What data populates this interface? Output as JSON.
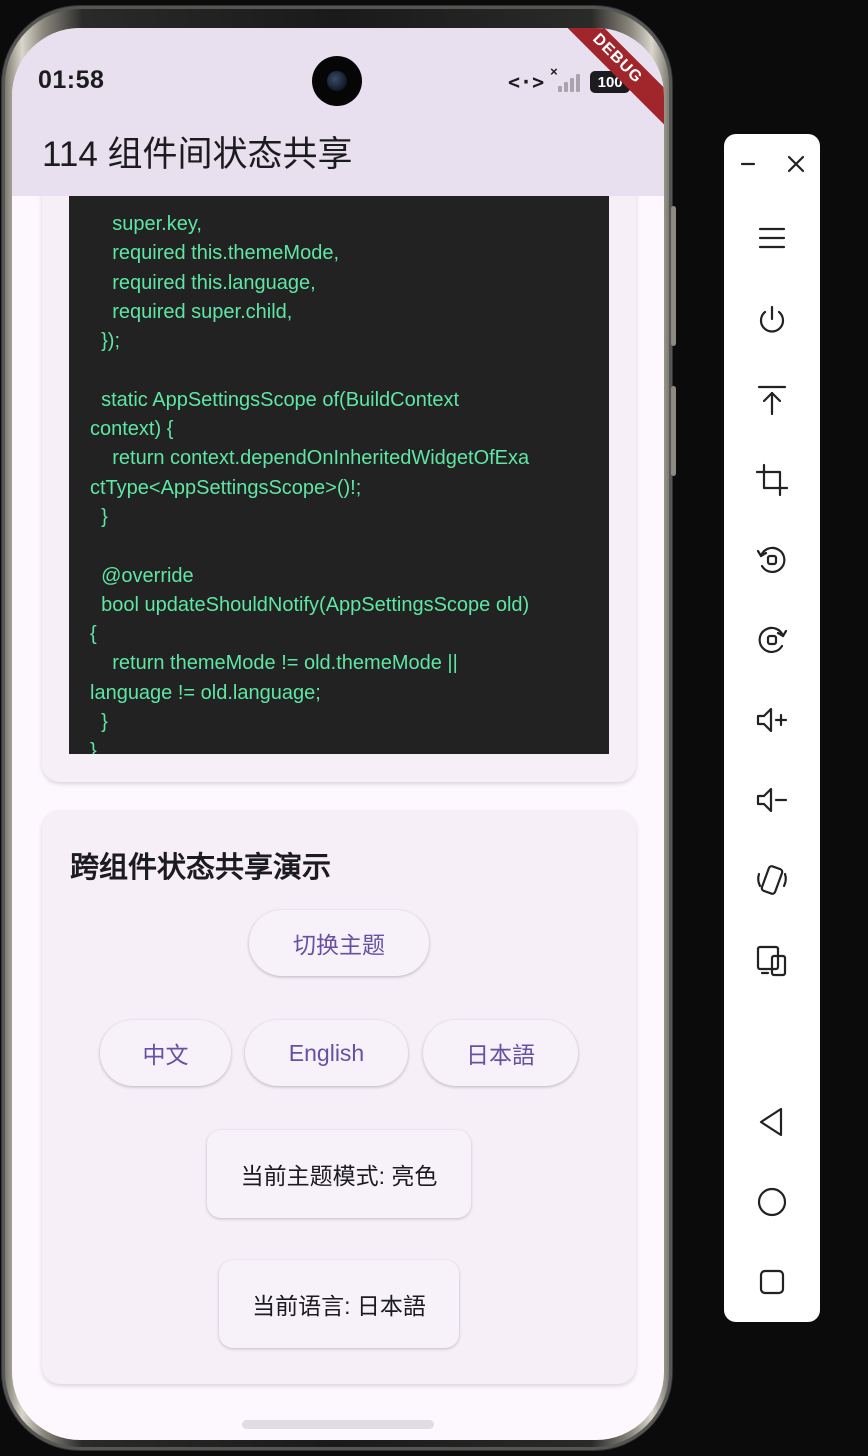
{
  "status_bar": {
    "time": "01:58",
    "battery": "100",
    "network_glyph": "<·>",
    "signal_mark": "×"
  },
  "debug_banner": "DEBUG",
  "app_bar": {
    "title": "114 组件间状态共享"
  },
  "code_block": {
    "lines": [
      "    super.key,",
      "    required this.themeMode,",
      "    required this.language,",
      "    required super.child,",
      "  });",
      "",
      "  static AppSettingsScope of(BuildContext",
      "context) {",
      "    return context.dependOnInheritedWidgetOfExa",
      "ctType<AppSettingsScope>()!;",
      "  }",
      "",
      "  @override",
      "  bool updateShouldNotify(AppSettingsScope old)",
      "{",
      "    return themeMode != old.themeMode ||",
      "language != old.language;",
      "  }",
      "}"
    ],
    "text_color": "#5ee6a4",
    "background": "#222222"
  },
  "demo": {
    "title": "跨组件状态共享演示",
    "toggle_theme_label": "切换主题",
    "language_buttons": [
      "中文",
      "English",
      "日本語"
    ],
    "current_theme_text": "当前主题模式: 亮色",
    "current_language_text": "当前语言: 日本語",
    "accent_color": "#6750a4"
  },
  "emulator_toolbar": {
    "icons": [
      "minimize-icon",
      "close-icon",
      "menu-icon",
      "power-icon",
      "upload-icon",
      "crop-icon",
      "rotate-left-icon",
      "rotate-right-icon",
      "volume-up-icon",
      "volume-down-icon",
      "shake-icon",
      "multi-device-icon",
      "back-icon",
      "home-icon",
      "recents-icon"
    ]
  }
}
